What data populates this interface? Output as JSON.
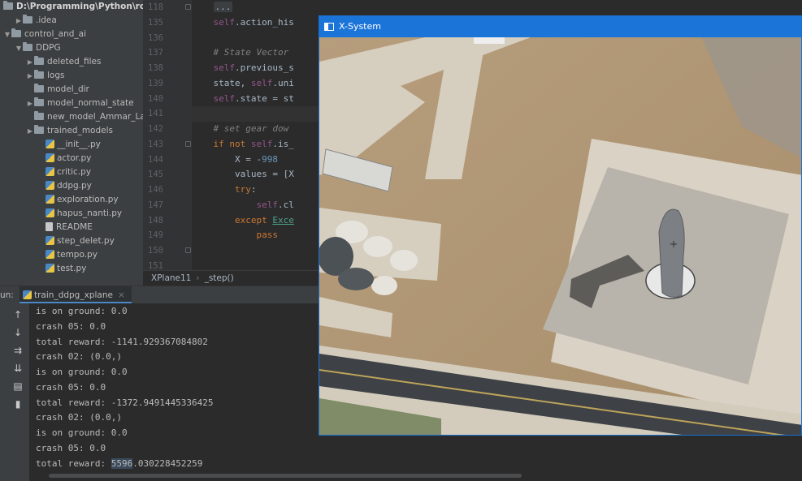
{
  "project": {
    "root_path": "D:\\Programming\\Python\\rocket",
    "items": [
      {
        "label": ".idea",
        "kind": "folder",
        "depth": 1,
        "expanded": false
      },
      {
        "label": "control_and_ai",
        "kind": "folder",
        "depth": 0,
        "expanded": true
      },
      {
        "label": "DDPG",
        "kind": "folder",
        "depth": 1,
        "expanded": true
      },
      {
        "label": "deleted_files",
        "kind": "folder",
        "depth": 2,
        "expanded": false
      },
      {
        "label": "logs",
        "kind": "folder",
        "depth": 2,
        "expanded": false
      },
      {
        "label": "model_dir",
        "kind": "folder",
        "depth": 2,
        "expanded": null
      },
      {
        "label": "model_normal_state",
        "kind": "folder",
        "depth": 2,
        "expanded": false
      },
      {
        "label": "new_model_Ammar_Lap",
        "kind": "folder",
        "depth": 2,
        "expanded": null
      },
      {
        "label": "trained_models",
        "kind": "folder",
        "depth": 2,
        "expanded": false
      },
      {
        "label": "__init__.py",
        "kind": "py",
        "depth": 3
      },
      {
        "label": "actor.py",
        "kind": "py",
        "depth": 3
      },
      {
        "label": "critic.py",
        "kind": "py",
        "depth": 3
      },
      {
        "label": "ddpg.py",
        "kind": "py",
        "depth": 3
      },
      {
        "label": "exploration.py",
        "kind": "py",
        "depth": 3
      },
      {
        "label": "hapus_nanti.py",
        "kind": "py",
        "depth": 3
      },
      {
        "label": "README",
        "kind": "txt",
        "depth": 3
      },
      {
        "label": "step_delet.py",
        "kind": "py",
        "depth": 3
      },
      {
        "label": "tempo.py",
        "kind": "py",
        "depth": 3
      },
      {
        "label": "test.py",
        "kind": "py",
        "depth": 3
      }
    ]
  },
  "editor": {
    "line_numbers": [
      "118",
      "135",
      "136",
      "137",
      "138",
      "139",
      "140",
      "141",
      "142",
      "143",
      "144",
      "145",
      "146",
      "147",
      "148",
      "149",
      "150",
      "151"
    ],
    "lines": [
      {
        "segments": [
          {
            "t": "    ",
            "c": ""
          },
          {
            "t": "...",
            "c": "fold-dots"
          }
        ]
      },
      {
        "segments": [
          {
            "t": "    ",
            "c": ""
          },
          {
            "t": "self",
            "c": "tk-self"
          },
          {
            "t": ".action_his",
            "c": ""
          }
        ]
      },
      {
        "segments": [
          {
            "t": "",
            "c": ""
          }
        ]
      },
      {
        "segments": [
          {
            "t": "    ",
            "c": ""
          },
          {
            "t": "# State Vector",
            "c": "tk-cm"
          }
        ]
      },
      {
        "segments": [
          {
            "t": "    ",
            "c": ""
          },
          {
            "t": "self",
            "c": "tk-self"
          },
          {
            "t": ".previous_s",
            "c": ""
          }
        ]
      },
      {
        "segments": [
          {
            "t": "    state, ",
            "c": ""
          },
          {
            "t": "self",
            "c": "tk-self"
          },
          {
            "t": ".uni",
            "c": ""
          }
        ]
      },
      {
        "segments": [
          {
            "t": "    ",
            "c": ""
          },
          {
            "t": "self",
            "c": "tk-self"
          },
          {
            "t": ".state = st",
            "c": ""
          }
        ]
      },
      {
        "segments": [
          {
            "t": "",
            "c": ""
          }
        ],
        "active": true
      },
      {
        "segments": [
          {
            "t": "    ",
            "c": ""
          },
          {
            "t": "# set gear dow",
            "c": "tk-cm"
          }
        ]
      },
      {
        "segments": [
          {
            "t": "    ",
            "c": ""
          },
          {
            "t": "if not ",
            "c": "tk-kw"
          },
          {
            "t": "self",
            "c": "tk-self"
          },
          {
            "t": ".is_",
            "c": ""
          }
        ]
      },
      {
        "segments": [
          {
            "t": "        X = -",
            "c": ""
          },
          {
            "t": "998",
            "c": "tk-num"
          }
        ]
      },
      {
        "segments": [
          {
            "t": "        values = [X",
            "c": ""
          }
        ]
      },
      {
        "segments": [
          {
            "t": "        ",
            "c": ""
          },
          {
            "t": "try",
            "c": "tk-kw"
          },
          {
            "t": ":",
            "c": ""
          }
        ]
      },
      {
        "segments": [
          {
            "t": "            ",
            "c": ""
          },
          {
            "t": "self",
            "c": "tk-self"
          },
          {
            "t": ".cl",
            "c": ""
          }
        ]
      },
      {
        "segments": [
          {
            "t": "        ",
            "c": ""
          },
          {
            "t": "except ",
            "c": "tk-kw"
          },
          {
            "t": "Exce",
            "c": "tk-cls"
          }
        ]
      },
      {
        "segments": [
          {
            "t": "            ",
            "c": ""
          },
          {
            "t": "pass",
            "c": "tk-kw"
          }
        ]
      },
      {
        "segments": [
          {
            "t": "",
            "c": ""
          }
        ]
      },
      {
        "segments": [
          {
            "t": "",
            "c": ""
          }
        ]
      }
    ]
  },
  "breadcrumb": {
    "class_name": "XPlane11",
    "method_name": "_step()",
    "separator": "›"
  },
  "run_panel": {
    "label": "un:",
    "tab_label": "train_ddpg_xplane",
    "close_glyph": "×",
    "toolbar": [
      "up-arrow",
      "down-arrow",
      "soft-wrap",
      "scroll-to-end",
      "print",
      "trash"
    ],
    "lines": [
      "is on ground: 0.0",
      "crash 05: 0.0",
      "total reward: -1141.929367084802",
      "crash 02: (0.0,)",
      "is on ground: 0.0",
      "crash 05: 0.0",
      "total reward: -1372.9491445336425",
      "crash 02: (0.0,)",
      "is on ground: 0.0",
      "crash 05: 0.0",
      "total reward: 5596.030228452259"
    ],
    "highlight": {
      "line": 10,
      "prefix": "total reward: ",
      "selected": "5596",
      "rest": ".030228452259"
    }
  },
  "xsystem": {
    "title": "X-System",
    "title_color": "#1b74d8"
  },
  "colors": {
    "accent": "#4a88c7",
    "keyword": "#cc7832",
    "self_kw": "#94558d",
    "comment": "#808080",
    "number": "#6897bb"
  }
}
